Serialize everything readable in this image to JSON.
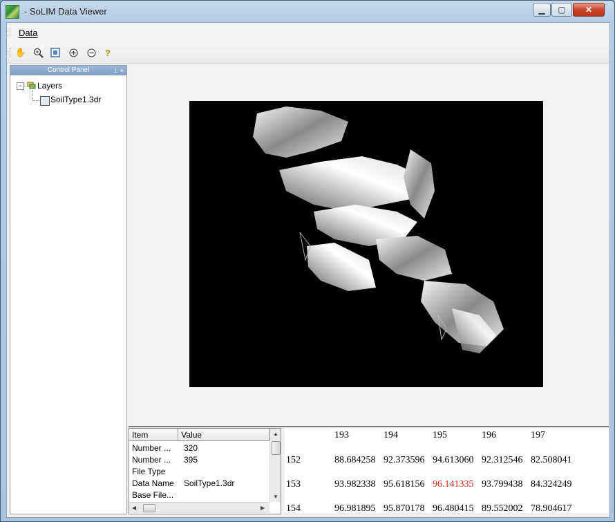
{
  "window": {
    "title": "- SoLIM Data Viewer"
  },
  "menu": {
    "items": [
      "Data"
    ]
  },
  "toolbar": {
    "tools": [
      "pan-icon",
      "zoom-in-icon",
      "full-extent-icon",
      "zoom-plus-icon",
      "zoom-minus-icon",
      "help-icon"
    ]
  },
  "control_panel": {
    "title": "Control Panel",
    "tree": {
      "root": "Layers",
      "child": "SoilType1.3dr"
    }
  },
  "properties": {
    "columns": [
      "Item",
      "Value"
    ],
    "rows": [
      {
        "item": "Number ...",
        "value": "320"
      },
      {
        "item": "Number ...",
        "value": "395"
      },
      {
        "item": "File Type",
        "value": ""
      },
      {
        "item": "Data Name",
        "value": "SoilType1.3dr"
      },
      {
        "item": "Base File...",
        "value": ""
      }
    ]
  },
  "data_grid": {
    "columns": [
      "193",
      "194",
      "195",
      "196",
      "197"
    ],
    "rows": [
      {
        "index": "152",
        "values": [
          "88.684258",
          "92.373596",
          "94.613060",
          "92.312546",
          "82.508041"
        ]
      },
      {
        "index": "153",
        "values": [
          "93.982338",
          "95.618156",
          "96.141335",
          "93.799438",
          "84.324249"
        ]
      },
      {
        "index": "154",
        "values": [
          "96.981895",
          "95.870178",
          "96.480415",
          "89.552002",
          "78.904617"
        ]
      }
    ],
    "highlight": {
      "row": "153",
      "column": "195",
      "color": "#e0231b"
    }
  }
}
